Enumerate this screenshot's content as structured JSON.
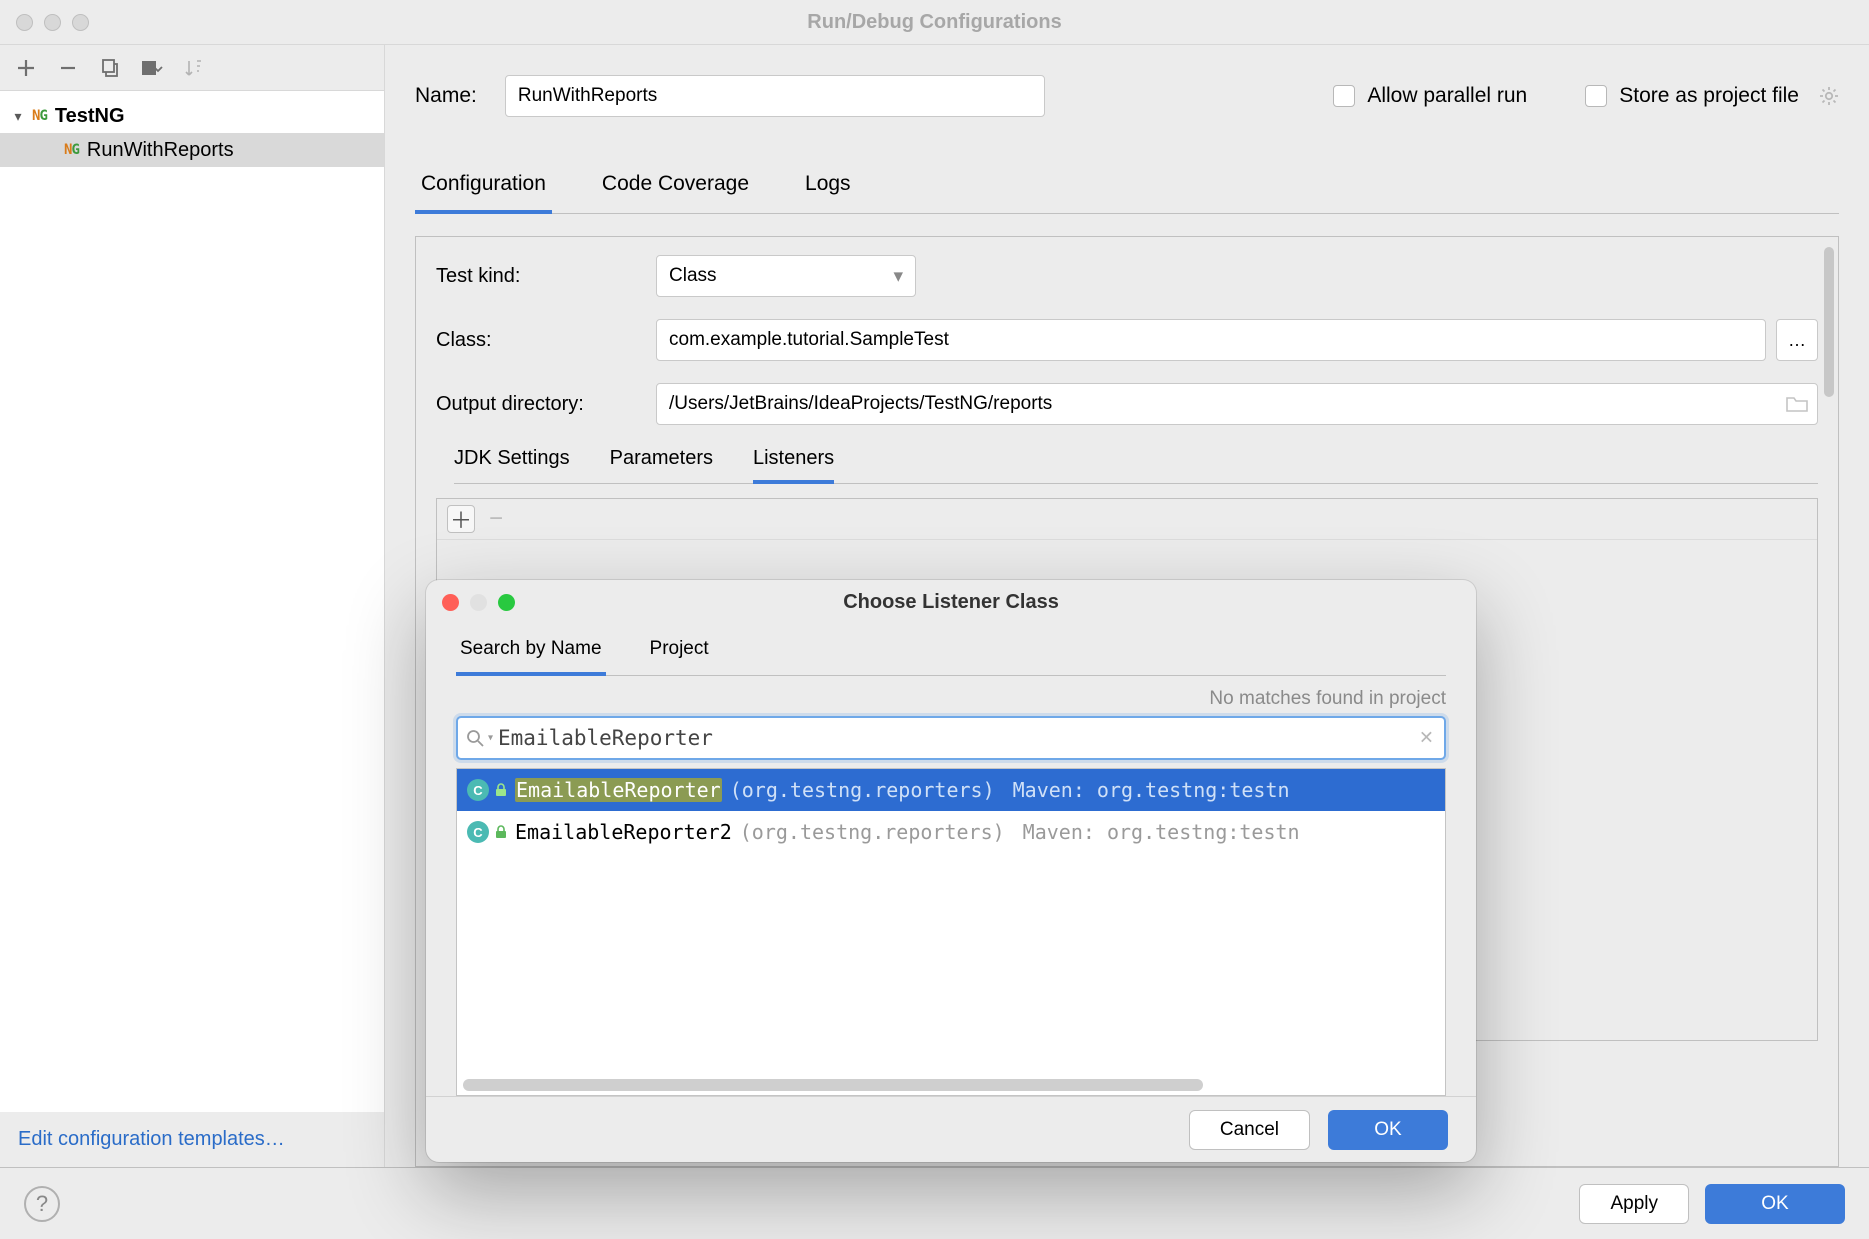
{
  "window": {
    "title": "Run/Debug Configurations"
  },
  "sidebar": {
    "root": "TestNG",
    "child": "RunWithReports",
    "footer_link": "Edit configuration templates…"
  },
  "form": {
    "name_label": "Name:",
    "name_value": "RunWithReports",
    "allow_parallel": "Allow parallel run",
    "store_as_file": "Store as project file",
    "tabs": [
      "Configuration",
      "Code Coverage",
      "Logs"
    ],
    "test_kind_label": "Test kind:",
    "test_kind_value": "Class",
    "class_label": "Class:",
    "class_value": "com.example.tutorial.SampleTest",
    "output_label": "Output directory:",
    "output_value": "/Users/JetBrains/IdeaProjects/TestNG/reports",
    "subtabs": [
      "JDK Settings",
      "Parameters",
      "Listeners"
    ]
  },
  "main_buttons": {
    "apply": "Apply",
    "ok": "OK"
  },
  "modal": {
    "title": "Choose Listener Class",
    "tabs": [
      "Search by Name",
      "Project"
    ],
    "hint": "No matches found in project",
    "search_value": "EmailableReporter",
    "results": [
      {
        "name": "EmailableReporter",
        "package": "(org.testng.reporters)",
        "source": "Maven: org.testng:testn"
      },
      {
        "name": "EmailableReporter2",
        "package": "(org.testng.reporters)",
        "source": "Maven: org.testng:testn"
      }
    ],
    "cancel": "Cancel",
    "ok": "OK"
  }
}
